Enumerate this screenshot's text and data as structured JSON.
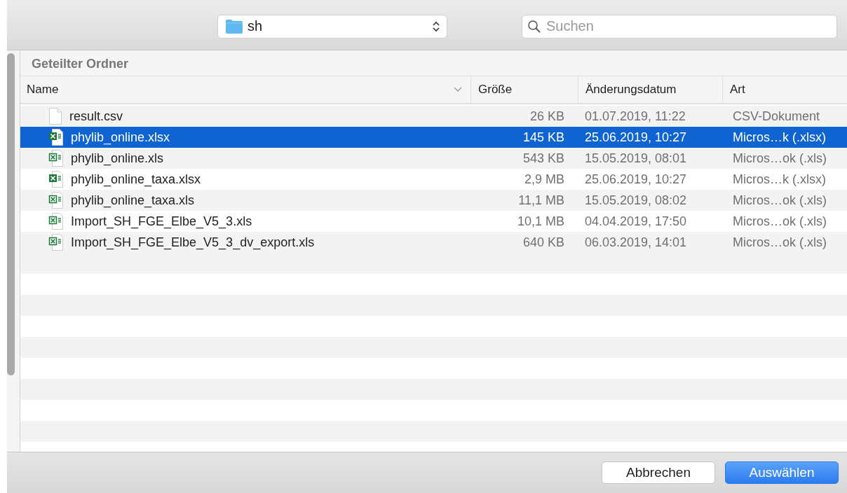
{
  "toolbar": {
    "location": "sh",
    "search": {
      "placeholder": "Suchen"
    }
  },
  "section_title": "Geteilter Ordner",
  "table": {
    "columns": [
      "Name",
      "Größe",
      "Änderungsdatum",
      "Art"
    ],
    "rows": [
      {
        "kind": "csv",
        "name": "result.csv",
        "size": "26 KB",
        "date": "01.07.2019, 11:22",
        "type": "CSV-Dokument",
        "selected": false
      },
      {
        "kind": "xlsx",
        "name": "phylib_online.xlsx",
        "size": "145 KB",
        "date": "25.06.2019, 10:27",
        "type": "Micros…k (.xlsx)",
        "selected": true
      },
      {
        "kind": "xls",
        "name": "phylib_online.xls",
        "size": "543 KB",
        "date": "15.05.2019, 08:01",
        "type": "Micros…ok (.xls)",
        "selected": false
      },
      {
        "kind": "xlsx",
        "name": "phylib_online_taxa.xlsx",
        "size": "2,9 MB",
        "date": "25.06.2019, 10:27",
        "type": "Micros…k (.xlsx)",
        "selected": false
      },
      {
        "kind": "xls",
        "name": "phylib_online_taxa.xls",
        "size": "11,1 MB",
        "date": "15.05.2019, 08:02",
        "type": "Micros…ok (.xls)",
        "selected": false
      },
      {
        "kind": "xls",
        "name": "Import_SH_FGE_Elbe_V5_3.xls",
        "size": "10,1 MB",
        "date": "04.04.2019, 17:50",
        "type": "Micros…ok (.xls)",
        "selected": false
      },
      {
        "kind": "xls",
        "name": "Import_SH_FGE_Elbe_V5_3_dv_export.xls",
        "size": "640 KB",
        "date": "06.03.2019, 14:01",
        "type": "Micros…ok (.xls)",
        "selected": false
      }
    ]
  },
  "buttons": [
    {
      "label": "Abbrechen",
      "kind": "secondary"
    },
    {
      "label": "Auswählen",
      "kind": "primary"
    }
  ]
}
